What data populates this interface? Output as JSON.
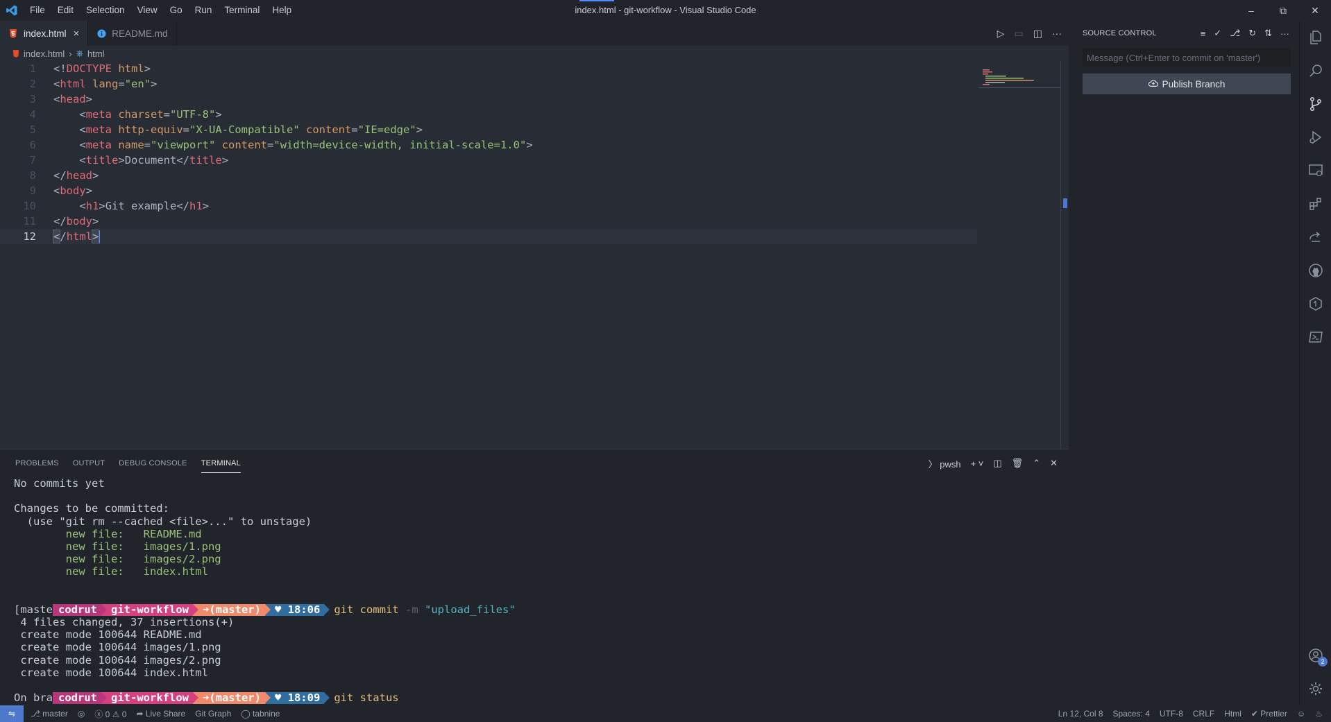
{
  "window": {
    "title": "index.html - git-workflow - Visual Studio Code",
    "menu": [
      "File",
      "Edit",
      "Selection",
      "View",
      "Go",
      "Run",
      "Terminal",
      "Help"
    ]
  },
  "tabs": [
    {
      "label": "index.html",
      "icon": "html5-icon",
      "active": true
    },
    {
      "label": "README.md",
      "icon": "info-icon",
      "active": false
    }
  ],
  "breadcrumb": {
    "file": "index.html",
    "symbol": "html"
  },
  "editor": {
    "line_numbers": [
      "1",
      "2",
      "3",
      "4",
      "5",
      "6",
      "7",
      "8",
      "9",
      "10",
      "11",
      "12"
    ],
    "current_line": 12
  },
  "panel": {
    "tabs": [
      "PROBLEMS",
      "OUTPUT",
      "DEBUG CONSOLE",
      "TERMINAL"
    ],
    "active_tab": "TERMINAL",
    "shell": "pwsh"
  },
  "terminal": {
    "lines_top": [
      "No commits yet",
      "",
      "Changes to be committed:",
      "  (use \"git rm --cached <file>...\" to unstage)"
    ],
    "staged": [
      {
        "label": "new file:",
        "file": "README.md"
      },
      {
        "label": "new file:",
        "file": "images/1.png"
      },
      {
        "label": "new file:",
        "file": "images/2.png"
      },
      {
        "label": "new file:",
        "file": "index.html"
      }
    ],
    "prompt1": {
      "user": "codrut",
      "dir": "git-workflow",
      "branch": "➜(master)",
      "time": "♥ 18:06",
      "cmd": "git commit",
      "flag": "-m",
      "arg": "\"upload_files\""
    },
    "output1": [
      "[master (root-commit) a3f2bd1] upload_files",
      " 4 files changed, 37 insertions(+)",
      " create mode 100644 README.md",
      " create mode 100644 images/1.png",
      " create mode 100644 images/2.png",
      " create mode 100644 index.html"
    ],
    "prompt2": {
      "user": "codrut",
      "dir": "git-workflow",
      "branch": "➜(master)",
      "time": "♥ 18:09",
      "cmd": "git status"
    },
    "output2": [
      "On branch master"
    ]
  },
  "sidebar": {
    "title": "SOURCE CONTROL",
    "commit_placeholder": "Message (Ctrl+Enter to commit on 'master')",
    "publish_label": "Publish Branch"
  },
  "activity_badge": "2",
  "statusbar": {
    "branch": "master",
    "problems": "ⓧ 0 ⚠ 0",
    "live_share": "Live Share",
    "git_graph": "Git Graph",
    "tabnine": "tabnine",
    "position": "Ln 12, Col 8",
    "spaces": "Spaces: 4",
    "encoding": "UTF-8",
    "eol": "CRLF",
    "language": "Html",
    "prettier": "✔ Prettier"
  },
  "colors": {
    "accent": "#528bff",
    "remote": "#4d78cc",
    "background": "#282c34"
  }
}
